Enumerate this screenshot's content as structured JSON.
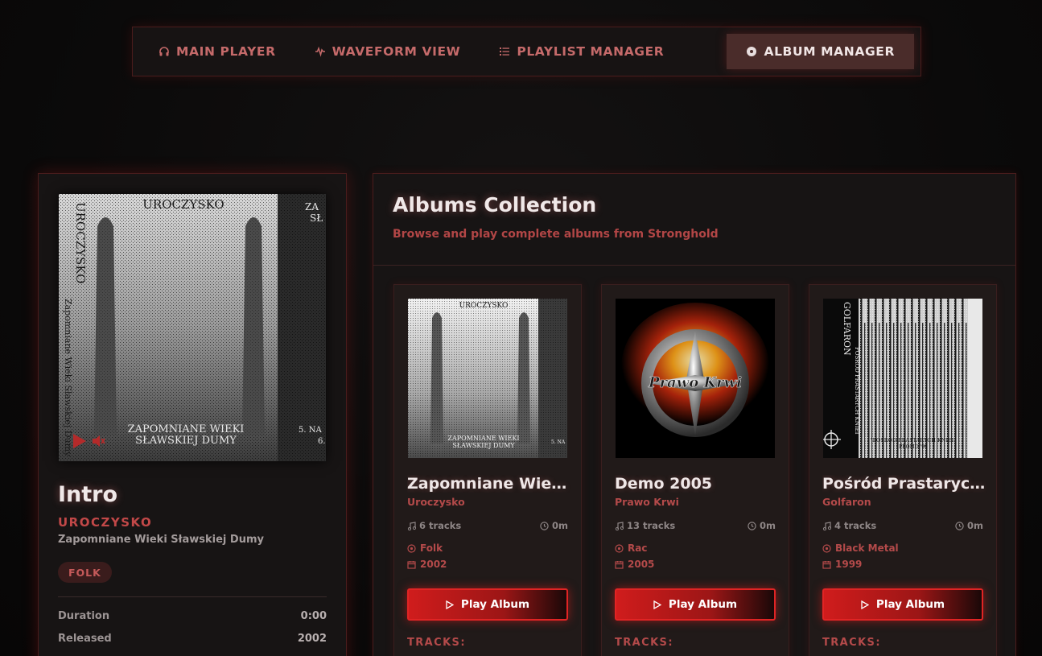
{
  "nav": {
    "tabs": [
      {
        "label": "MAIN PLAYER",
        "icon": "headphones-icon"
      },
      {
        "label": "WAVEFORM VIEW",
        "icon": "waveform-icon"
      },
      {
        "label": "PLAYLIST MANAGER",
        "icon": "list-icon"
      },
      {
        "label": "ALBUM MANAGER",
        "icon": "disc-icon",
        "active": true
      }
    ]
  },
  "now_playing": {
    "cover_text": {
      "band": "UROCZYSKO",
      "side": "UROCZYSKO",
      "side2": "Zapomniane Wieki Sławskiej Dumy",
      "banner_top": "ZAPOMNIANE WIEKI",
      "banner_bottom": "SŁAWSKIEJ DUMY",
      "edge_top": "ZA",
      "edge_top2": "SŁ",
      "edge_bottom": "5. NA",
      "edge_bottom2": "6."
    },
    "title": "Intro",
    "artist": "UROCZYSKO",
    "album": "Zapomniane Wieki Sławskiej Dumy",
    "genre": "FOLK",
    "details": [
      {
        "label": "Duration",
        "value": "0:00"
      },
      {
        "label": "Released",
        "value": "2002"
      }
    ]
  },
  "albums_panel": {
    "title": "Albums Collection",
    "subtitle": "Browse and play complete albums from Stronghold"
  },
  "albums": [
    {
      "title": "Zapomniane Wieki Sławskiej Dumy",
      "artist": "Uroczysko",
      "tracks": "6 tracks",
      "duration": "0m",
      "genre": "Folk",
      "year": "2002",
      "play_label": "Play Album",
      "tracks_heading": "TRACKS:",
      "cover_text": {
        "band": "UROCZYSKO",
        "banner_top": "ZAPOMNIANE WIEKI",
        "banner_bottom": "SŁAWSKIEJ DUMY",
        "edge": "5. NA"
      }
    },
    {
      "title": "Demo 2005",
      "artist": "Prawo Krwi",
      "tracks": "13 tracks",
      "duration": "0m",
      "genre": "Rac",
      "year": "2005",
      "play_label": "Play Album",
      "tracks_heading": "TRACKS:",
      "cover_text": {
        "logo": "Prawo Krwi"
      }
    },
    {
      "title": "Pośród Prastarych Kniei",
      "artist": "Golfaron",
      "tracks": "4 tracks",
      "duration": "0m",
      "genre": "Black Metal",
      "year": "1999",
      "play_label": "Play Album",
      "tracks_heading": "TRACKS:",
      "cover_text": {
        "band": "GOLFARON",
        "side": "POŚRÓD PRASTARYCH KNIEI",
        "caption": "\"POŚRÓD PRASTARYCH KNIEI\"",
        "caption2": "PROMO '99"
      }
    }
  ],
  "colors": {
    "accent": "#d01c1c",
    "accent_text": "#c24848",
    "panel_border": "#4a1c1c",
    "background": "#0b0a0a"
  }
}
